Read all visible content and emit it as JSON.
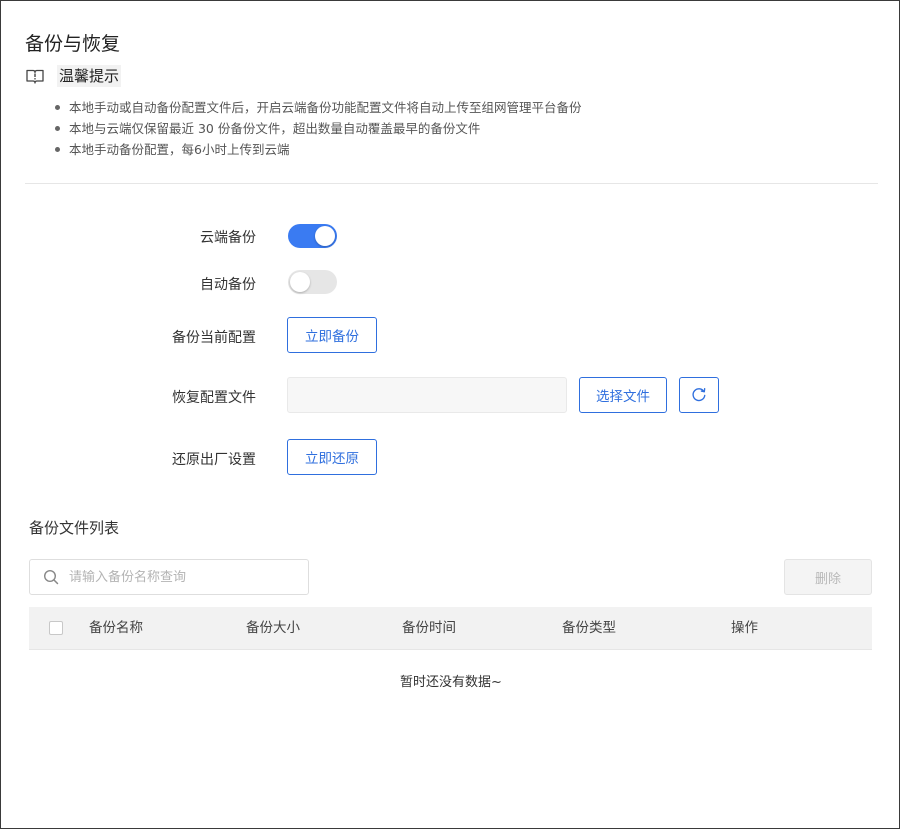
{
  "page": {
    "title": "备份与恢复"
  },
  "notice": {
    "title": "温馨提示",
    "icon": "info-book-icon",
    "items": [
      "本地手动或自动备份配置文件后，开启云端备份功能配置文件将自动上传至组网管理平台备份",
      "本地与云端仅保留最近 30 份备份文件，超出数量自动覆盖最早的备份文件",
      "本地手动备份配置，每6小时上传到云端"
    ]
  },
  "form": {
    "cloud_backup": {
      "label": "云端备份",
      "enabled": true
    },
    "auto_backup": {
      "label": "自动备份",
      "enabled": false
    },
    "backup_current": {
      "label": "备份当前配置",
      "button": "立即备份"
    },
    "restore_file": {
      "label": "恢复配置文件",
      "file_value": "",
      "choose_button": "选择文件",
      "refresh_icon": "refresh-icon"
    },
    "factory_reset": {
      "label": "还原出厂设置",
      "button": "立即还原"
    }
  },
  "list": {
    "title": "备份文件列表",
    "search": {
      "placeholder": "请输入备份名称查询",
      "value": "",
      "icon": "search-icon"
    },
    "delete_button": "删除",
    "columns": [
      "备份名称",
      "备份大小",
      "备份时间",
      "备份类型",
      "操作"
    ],
    "rows": [],
    "empty_text": "暂时还没有数据~"
  },
  "colors": {
    "primary": "#2f6fde",
    "switch_on": "#3a7bf2",
    "switch_off": "#e6e6e6"
  }
}
